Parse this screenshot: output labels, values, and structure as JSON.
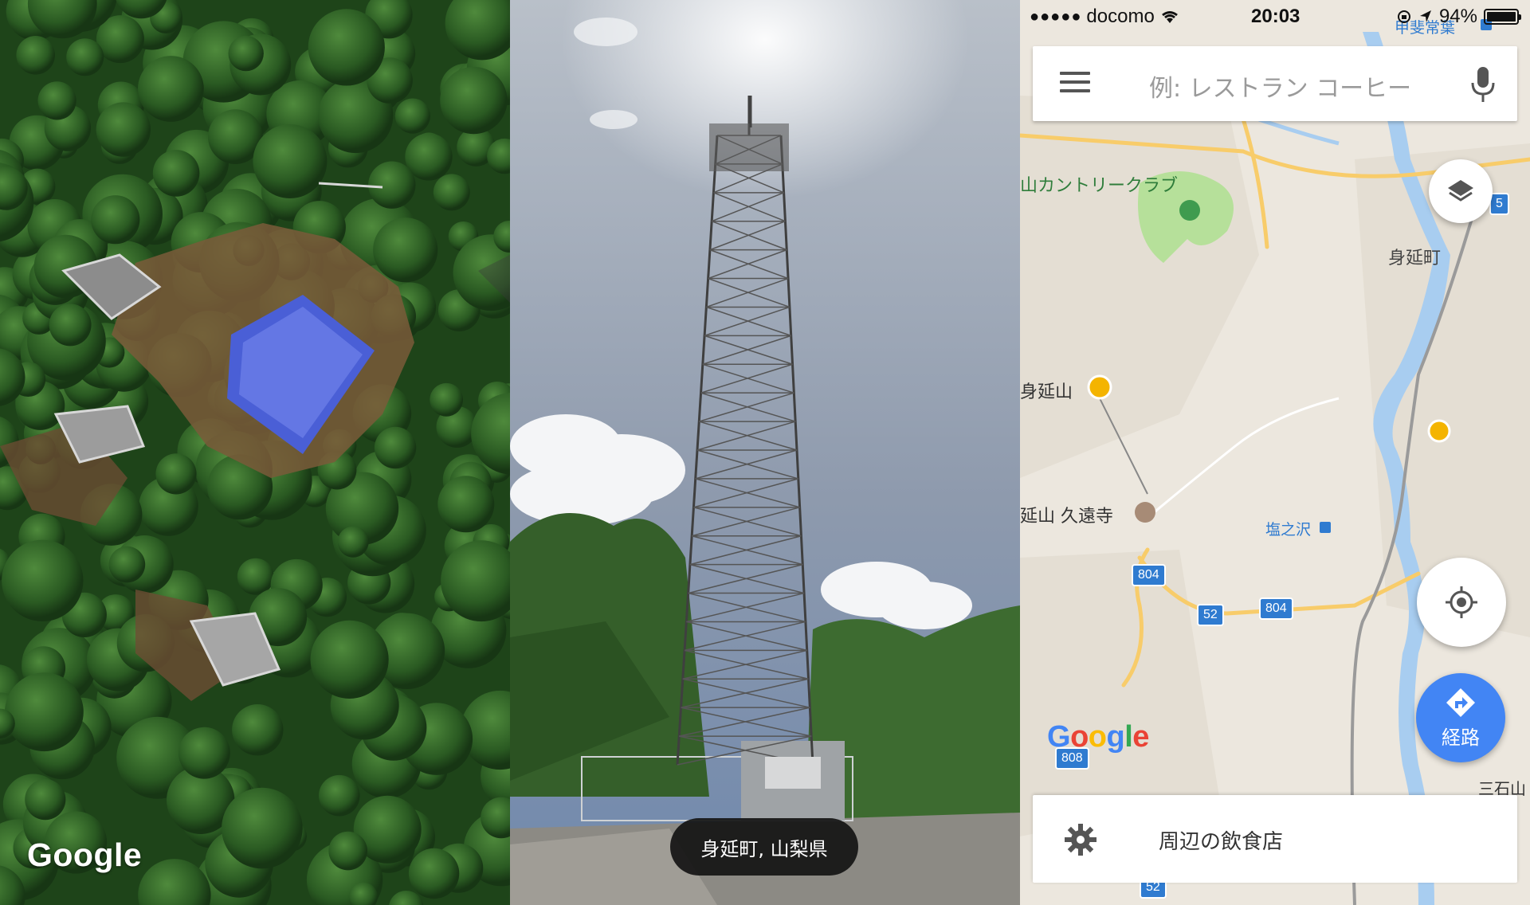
{
  "satellite": {
    "logo": "Google"
  },
  "streetview": {
    "location": "身延町, 山梨県"
  },
  "map": {
    "status": {
      "carrier": "docomo",
      "time": "20:03",
      "battery": "94%",
      "battery_level": 0.94
    },
    "search": {
      "placeholder": "例: レストラン コーヒー",
      "menu_icon": "hamburger-menu-icon",
      "mic_icon": "microphone-icon"
    },
    "labels": {
      "country_club": "山カントリークラブ",
      "town": "身延町",
      "mountain": "身延山",
      "temple": "延山 久遠寺",
      "station": "塩之沢",
      "kaikai": "甲斐常葉",
      "mitsuishi": "三石山"
    },
    "routes": {
      "r804a": "804",
      "r804b": "804",
      "r52": "52",
      "r808": "808",
      "r5": "5",
      "r52b": "52"
    },
    "logo": "Google",
    "route_button": "経路",
    "bottom": {
      "label": "周辺の飲食店",
      "icon": "gear-icon"
    },
    "colors": {
      "accent": "#4285f4",
      "water": "#a8cdf0",
      "park": "#b6e09a",
      "road": "#f8cc6a"
    }
  }
}
